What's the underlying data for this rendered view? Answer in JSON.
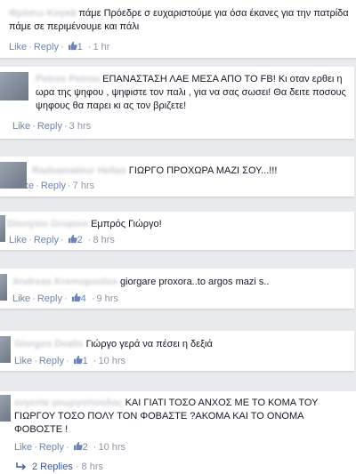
{
  "comments": [
    {
      "author": "Φρόσω Κογκά",
      "text": "πάμε Πρόεδρε σ ευχαριστούμε για όσα έκανες για την πατρίδα πάμε σε περιμένουμε και πάλι",
      "like": "Like",
      "reply": "Reply",
      "likes": "1",
      "time": "1 hr"
    },
    {
      "author": "Petros Petrou",
      "text": "ΕΠΑΝΑΣΤΑΣΗ ΛΑΕ ΜΕΣΑ ΑΠΟ ΤΟ FB! Κι οταν ερθει η ωρα της ψηφου , ψηφιστε τον παλι , για να σας σωσει! Θα δειτε ποσους ψηφους θα παρει κι ας τον βριζετε!",
      "like": "Like",
      "reply": "Reply",
      "likes": "",
      "time": "3 hrs"
    },
    {
      "author": "Radoamateur Hellas",
      "text": "ΓΙΩΡΓΟ ΠΡΟΧΩΡΑ ΜΑΖΙ ΣΟΥ...!!!",
      "like": "Like",
      "reply": "Reply",
      "likes": "",
      "time": "7 hrs"
    },
    {
      "author": "Dionysis Gropios",
      "text": "Εμπρός Γιώργο!",
      "like": "Like",
      "reply": "Reply",
      "likes": "2",
      "time": "8 hrs"
    },
    {
      "author": "Andreas Kremopoulos",
      "text": "giorgare proxora..to argos mazi s..",
      "like": "Like",
      "reply": "Reply",
      "likes": "4",
      "time": "9 hrs"
    },
    {
      "author": "Giorgos Dvalis",
      "text": "Γιώργο γερά να πέσει η δεξιά",
      "like": "Like",
      "reply": "Reply",
      "likes": "1",
      "time": "10 hrs"
    },
    {
      "author": "ευγενία γεωργοπουλος",
      "text": "ΚΑΙ ΓΙΑΤΙ ΤΟΣΟ ΑΝΧΟΣ ΜΕ ΤΟ ΚΟΜΑ ΤΟΥ ΓΙΩΡΓΟΥ ΤΟΣΟ ΠΟΛΥ ΤΟΝ ΦΟΒΑΣΤΕ ?ΑΚΟΜΑ ΚΑΙ ΤΟ ΟΝΟΜΑ ΦΟΒΟΣΤΕ !",
      "like": "Like",
      "reply": "Reply",
      "likes": "2",
      "time": "10 hrs"
    }
  ],
  "replies_link": {
    "label": "2 Replies",
    "time": "8 hrs"
  },
  "colors": {
    "link": "#3b5998",
    "action": "#6d84b4",
    "meta": "#9197a3",
    "background": "#e9eaed"
  }
}
